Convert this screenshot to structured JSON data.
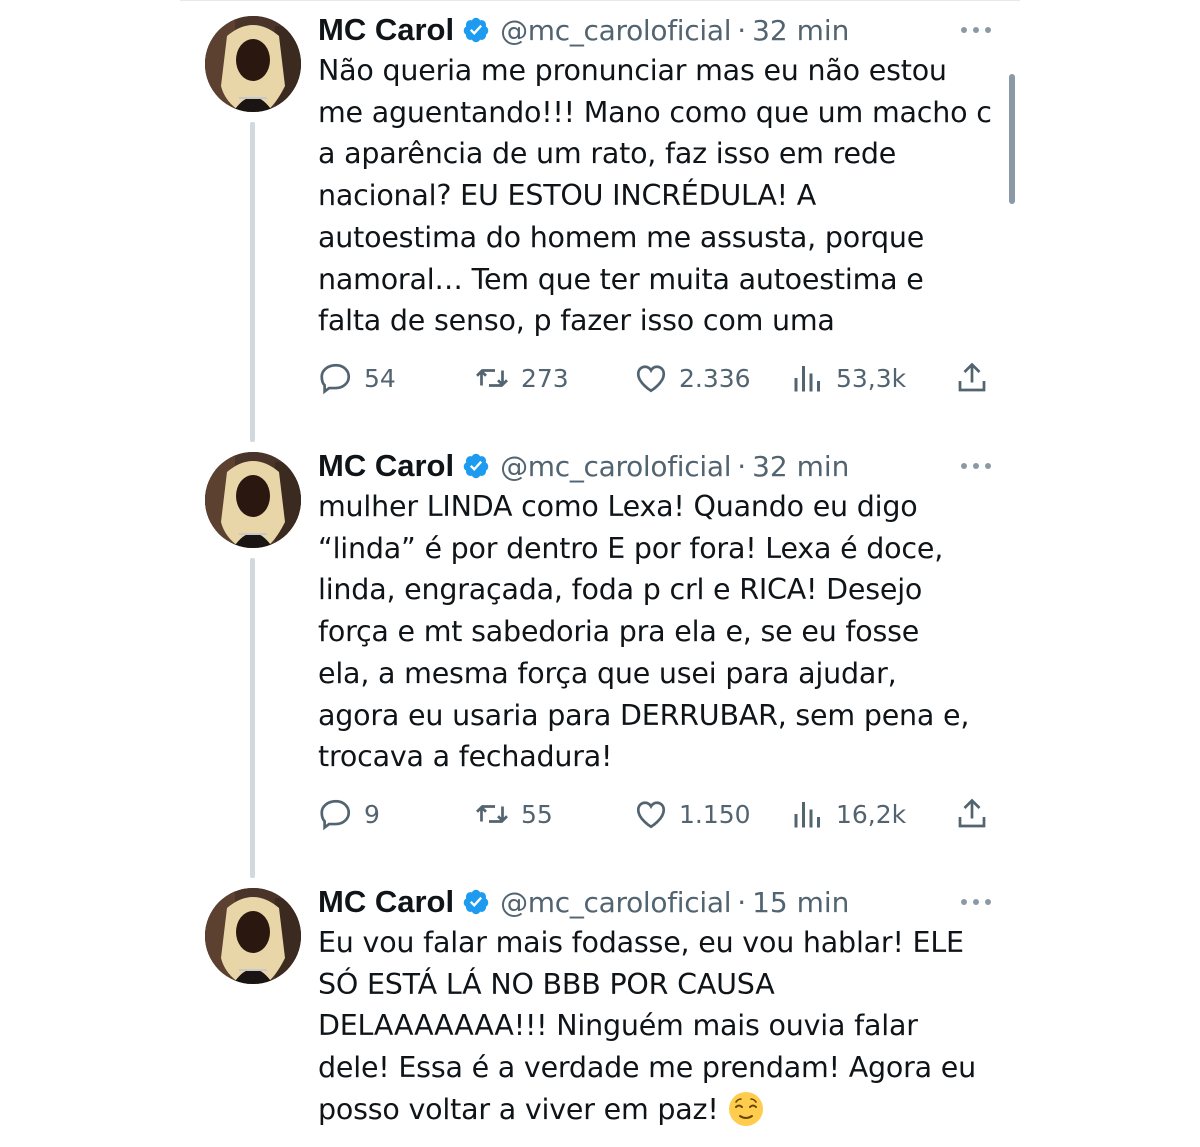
{
  "author": {
    "name": "MC Carol",
    "handle": "@mc_caroloficial",
    "verified_color": "#1d9bf0"
  },
  "tweets": [
    {
      "time": "32 min",
      "text": "Não queria me pronunciar mas eu não estou\nme aguentando!!! Mano como que um macho c\na aparência de um rato, faz isso em rede\nnacional? EU ESTOU INCRÉDULA! A\nautoestima do homem me assusta, porque\nnamoral… Tem que ter muita autoestima e\nfalta de senso, p fazer isso com uma",
      "replies": "54",
      "retweets": "273",
      "likes": "2.336",
      "views": "53,3k"
    },
    {
      "time": "32 min",
      "text": "mulher LINDA como Lexa! Quando eu digo\n“linda” é por dentro E por fora! Lexa é doce,\nlinda, engraçada, foda p crl e RICA! Desejo\nforça e mt sabedoria pra ela e, se eu fosse\nela, a mesma força que usei para ajudar,\nagora eu usaria para DERRUBAR, sem pena e,\ntrocava a fechadura!",
      "replies": "9",
      "retweets": "55",
      "likes": "1.150",
      "views": "16,2k"
    },
    {
      "time": "15 min",
      "text": "Eu vou falar mais fodasse, eu vou hablar!  ELE\nSÓ ESTÁ LÁ NO BBB POR CAUSA\nDELAAAAAAA!!! Ninguém mais ouvia falar\ndele! Essa é a verdade me prendam! Agora eu\nposso voltar a viver em paz!",
      "emoji": "relieved-face-icon"
    }
  ],
  "icons": {
    "reply": "reply-icon",
    "retweet": "retweet-icon",
    "like": "heart-icon",
    "views": "views-icon",
    "share": "share-icon",
    "more": "more-icon"
  },
  "colors": {
    "text": "#0f1419",
    "secondary": "#536471",
    "thread_line": "#cfd9de"
  }
}
